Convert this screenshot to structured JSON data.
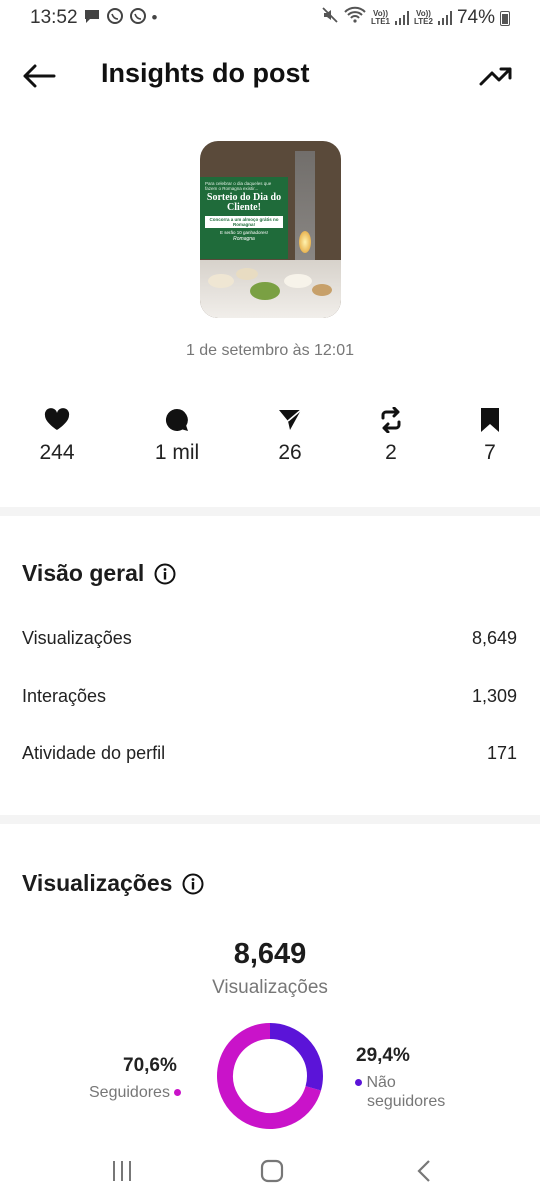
{
  "status_bar": {
    "time": "13:52",
    "bullet": "•",
    "sim1_top": "Vo))",
    "sim1_bottom": "LTE1",
    "sim2_top": "Vo))",
    "sim2_bottom": "LTE2",
    "battery": "74%"
  },
  "header": {
    "title": "Insights do post"
  },
  "post": {
    "thumbnail_small_text": "Para celebrar o dia daqueles que fazem o Romagna existir...",
    "thumbnail_headline": "Sorteio do Dia do Cliente!",
    "thumbnail_strip": "Concorra a um almoço grátis no Romagna!",
    "thumbnail_footer": "E serão 10 ganhadores!",
    "thumbnail_brand": "Romagna",
    "date": "1 de setembro às 12:01"
  },
  "stats": {
    "likes": "244",
    "comments": "1 mil",
    "shares": "26",
    "reposts": "2",
    "saves": "7"
  },
  "overview": {
    "title": "Visão geral",
    "rows": [
      {
        "label": "Visualizações",
        "value": "8,649"
      },
      {
        "label": "Interações",
        "value": "1,309"
      },
      {
        "label": "Atividade do perfil",
        "value": "171"
      }
    ]
  },
  "views": {
    "title": "Visualizações",
    "total": "8,649",
    "caption": "Visualizações",
    "followers_pct": "70,6%",
    "followers_label": "Seguidores",
    "nonfollowers_pct": "29,4%",
    "nonfollowers_label_1": "Não",
    "nonfollowers_label_2": "seguidores",
    "followers_fraction": 0.706,
    "nonfollowers_fraction": 0.294,
    "followers_color": "#c913c9",
    "nonfollowers_color": "#5b14d8"
  }
}
